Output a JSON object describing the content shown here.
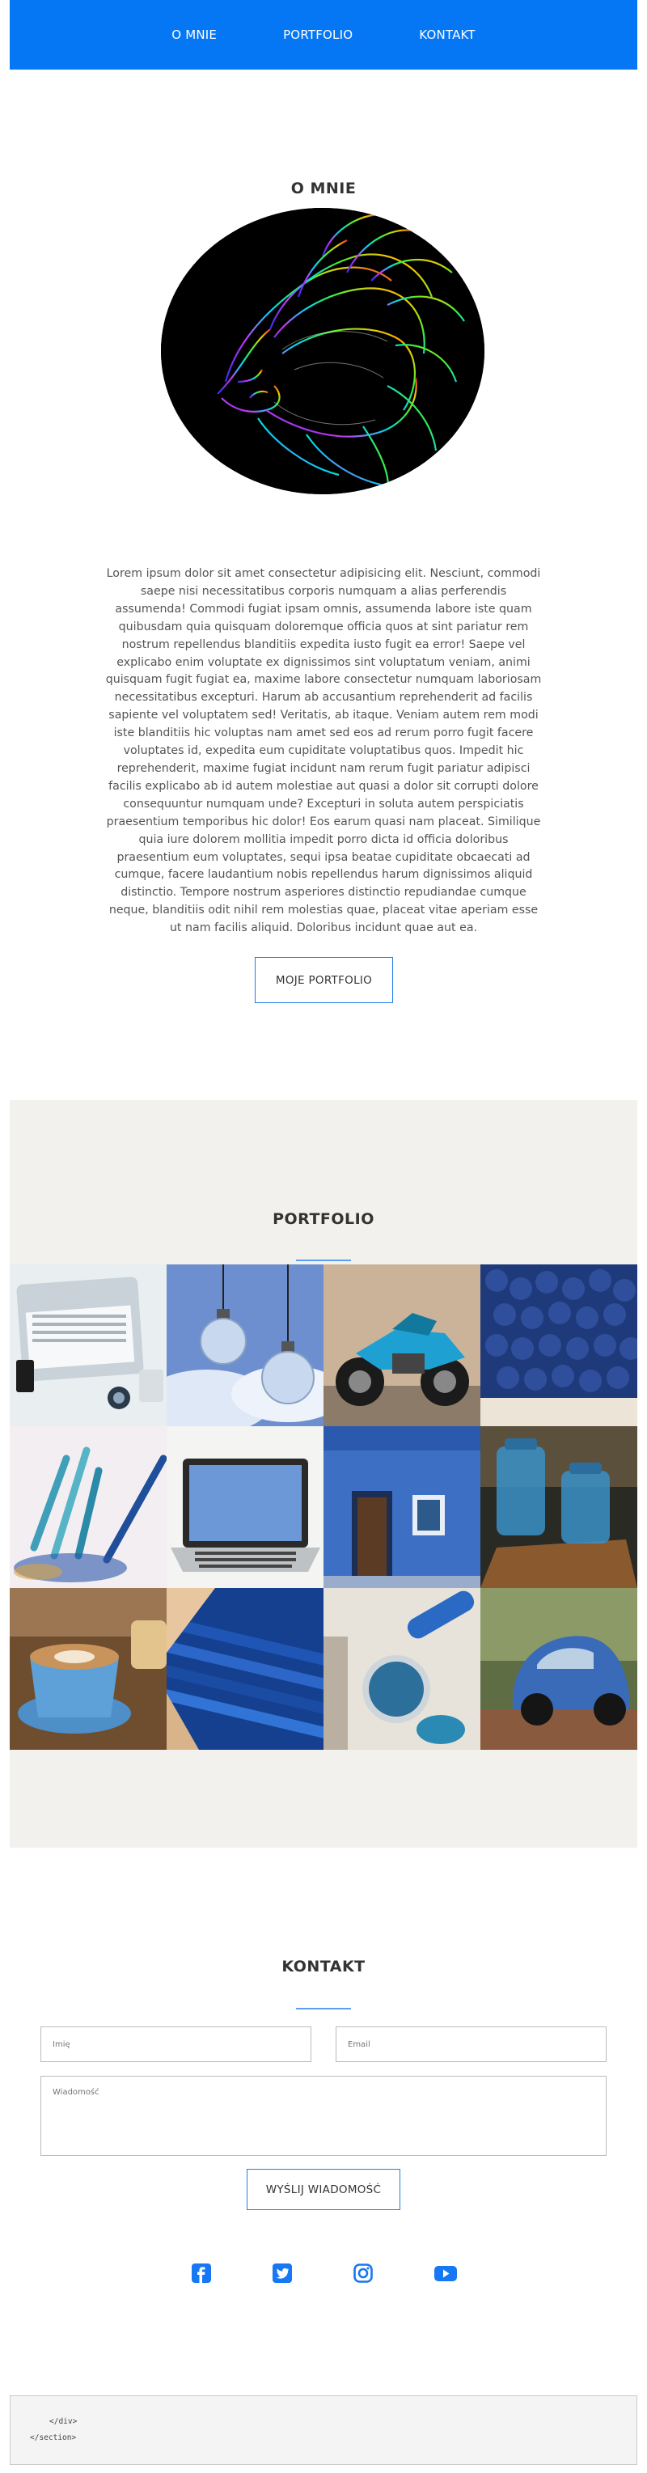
{
  "nav": {
    "items": [
      "O MNIE",
      "PORTFOLIO",
      "KONTAKT"
    ]
  },
  "about": {
    "title": "O MNIE",
    "text": "Lorem ipsum dolor sit amet consectetur adipisicing elit. Nesciunt, commodi saepe nisi necessitatibus corporis numquam a alias perferendis assumenda! Commodi fugiat ipsam omnis, assumenda labore iste quam quibusdam quia quisquam doloremque officia quos at sint pariatur rem nostrum repellendus blanditiis expedita iusto fugit ea error! Saepe vel explicabo enim voluptate ex dignissimos sint voluptatum veniam, animi quisquam fugit fugiat ea, maxime labore consectetur numquam laboriosam necessitatibus excepturi. Harum ab accusantium reprehenderit ad facilis sapiente vel voluptatem sed! Veritatis, ab itaque. Veniam autem rem modi iste blanditiis hic voluptas nam amet sed eos ad rerum porro fugit facere voluptates id, expedita eum cupiditate voluptatibus quos. Impedit hic reprehenderit, maxime fugiat incidunt nam rerum fugit pariatur adipisci facilis explicabo ab id autem molestiae aut quasi a dolor sit corrupti dolore consequuntur numquam unde? Excepturi in soluta autem perspiciatis praesentium temporibus hic dolor! Eos earum quasi nam placeat. Similique quia iure dolorem mollitia impedit porro dicta id officia doloribus praesentium eum voluptates, sequi ipsa beatae cupiditate obcaecati ad cumque, facere laudantium nobis repellendus harum dignissimos aliquid distinctio. Tempore nostrum asperiores distinctio repudiandae cumque neque, blanditiis odit nihil rem molestias quae, placeat vitae aperiam esse ut nam facilis aliquid. Doloribus incidunt quae aut ea.",
    "button": "MOJE PORTFOLIO"
  },
  "portfolio": {
    "title": "PORTFOLIO",
    "tiles": [
      "laptop",
      "light-bulbs",
      "motorcycle",
      "blueberries",
      "colored-pencils",
      "laptop-on-table",
      "blue-house",
      "blue-jars",
      "coffee-cup",
      "blue-pencils",
      "paint-can",
      "blue-beetle-car"
    ]
  },
  "contact": {
    "title": "KONTAKT",
    "name_placeholder": "Imię",
    "email_placeholder": "Email",
    "message_placeholder": "Wiadomość",
    "submit": "WYŚLIJ WIADOMOŚĆ",
    "social_icons": [
      "facebook-icon",
      "twitter-icon",
      "instagram-icon",
      "youtube-icon"
    ]
  },
  "footer": {
    "line1": "</div>",
    "line2": "</section>"
  },
  "colors": {
    "accent": "#0577f5",
    "portfolio_bg": "#f2f1ed"
  }
}
